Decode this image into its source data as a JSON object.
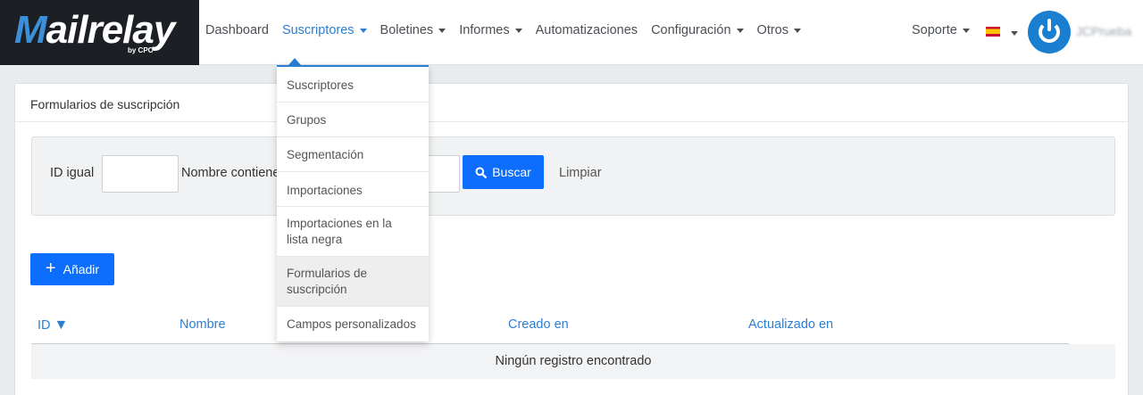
{
  "brand": {
    "name": "Mailrelay",
    "logo_first": "M",
    "logo_rest": "ailrelay",
    "byline": "by CPC"
  },
  "nav": {
    "items": [
      {
        "label": "Dashboard",
        "has_caret": false
      },
      {
        "label": "Suscriptores",
        "has_caret": true,
        "active": true
      },
      {
        "label": "Boletines",
        "has_caret": true
      },
      {
        "label": "Informes",
        "has_caret": true
      },
      {
        "label": "Automatizaciones",
        "has_caret": false
      },
      {
        "label": "Configuración",
        "has_caret": true
      },
      {
        "label": "Otros",
        "has_caret": true
      }
    ],
    "support": "Soporte",
    "username": "JCPrueba",
    "accent_color": "#2a7fd4"
  },
  "dropdown": {
    "items": [
      "Suscriptores",
      "Grupos",
      "Segmentación",
      "Importaciones",
      "Importaciones en la lista negra",
      "Formularios de suscripción",
      "Campos personalizados"
    ],
    "selected_index": 5
  },
  "page": {
    "title": "Formularios de suscripción",
    "filter": {
      "id_label": "ID igual",
      "id_value": "",
      "name_label": "Nombre contiene",
      "name_value": "",
      "search_button": "Buscar",
      "clear_link": "Limpiar"
    },
    "add_button": "Añadir",
    "table": {
      "columns": [
        "ID",
        "Nombre",
        "Creado en",
        "Actualizado en"
      ],
      "sort_indicator": "▼",
      "empty_message": "Ningún registro encontrado"
    },
    "button_color": "#0d6efd"
  }
}
